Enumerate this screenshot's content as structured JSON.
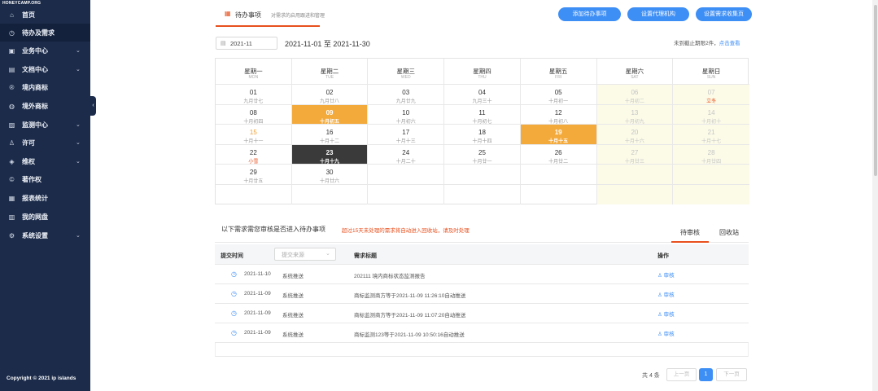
{
  "sidebar": {
    "logo": "HONEYCAMP.ORG",
    "items": [
      {
        "label": "首页",
        "icon": "home-icon",
        "glyph": "⌂",
        "caret": false,
        "active": false
      },
      {
        "label": "待办及需求",
        "icon": "clock-icon",
        "glyph": "◷",
        "caret": false,
        "active": true
      },
      {
        "label": "业务中心",
        "icon": "briefcase-icon",
        "glyph": "▣",
        "caret": true,
        "active": false
      },
      {
        "label": "文档中心",
        "icon": "document-icon",
        "glyph": "▤",
        "caret": true,
        "active": false
      },
      {
        "label": "境内商标",
        "icon": "registered-icon",
        "glyph": "®",
        "caret": false,
        "active": false
      },
      {
        "label": "境外商标",
        "icon": "globe-icon",
        "glyph": "◍",
        "caret": false,
        "active": false
      },
      {
        "label": "监测中心",
        "icon": "monitor-icon",
        "glyph": "▨",
        "caret": true,
        "active": false
      },
      {
        "label": "许可",
        "icon": "user-icon",
        "glyph": "♙",
        "caret": true,
        "active": false
      },
      {
        "label": "维权",
        "icon": "shield-icon",
        "glyph": "◈",
        "caret": true,
        "active": false
      },
      {
        "label": "著作权",
        "icon": "copyright-icon",
        "glyph": "©",
        "caret": false,
        "active": false
      },
      {
        "label": "报表统计",
        "icon": "chart-icon",
        "glyph": "▦",
        "caret": false,
        "active": false
      },
      {
        "label": "我的网盘",
        "icon": "disk-icon",
        "glyph": "▥",
        "caret": false,
        "active": false
      },
      {
        "label": "系统设置",
        "icon": "gear-icon",
        "glyph": "⚙",
        "caret": true,
        "active": false
      }
    ],
    "copyright": "Copyright © 2021 ip islands"
  },
  "header": {
    "tab_title": "待办事项",
    "tab_subtitle": "对需求的启用跟进和管理",
    "buttons": [
      "添加待办事项",
      "设置代理机构",
      "设置需求收集页"
    ]
  },
  "calendar": {
    "month": "2021-11",
    "range": "2021-11-01 至 2021-11-30",
    "deadline_text": "未到截止期限2件，",
    "deadline_link": "点击查看",
    "weekdays": [
      {
        "cn": "星期一",
        "en": "MON"
      },
      {
        "cn": "星期二",
        "en": "TUE"
      },
      {
        "cn": "星期三",
        "en": "WED"
      },
      {
        "cn": "星期四",
        "en": "THU"
      },
      {
        "cn": "星期五",
        "en": "FRI"
      },
      {
        "cn": "星期六",
        "en": "SAT"
      },
      {
        "cn": "星期日",
        "en": "SUN"
      }
    ],
    "weeks": [
      [
        {
          "n": "01",
          "l": "九月廿七"
        },
        {
          "n": "02",
          "l": "九月廿八"
        },
        {
          "n": "03",
          "l": "九月廿九"
        },
        {
          "n": "04",
          "l": "九月三十"
        },
        {
          "n": "05",
          "l": "十月初一"
        },
        {
          "n": "06",
          "l": "十月初二"
        },
        {
          "n": "07",
          "l": "立冬",
          "red": true
        }
      ],
      [
        {
          "n": "08",
          "l": "十月初四"
        },
        {
          "n": "09",
          "l": "十月初五",
          "hl": true
        },
        {
          "n": "10",
          "l": "十月初六"
        },
        {
          "n": "11",
          "l": "十月初七"
        },
        {
          "n": "12",
          "l": "十月初八"
        },
        {
          "n": "13",
          "l": "十月初九"
        },
        {
          "n": "14",
          "l": "十月初十"
        }
      ],
      [
        {
          "n": "15",
          "l": "十月十一",
          "orange": true
        },
        {
          "n": "16",
          "l": "十月十二"
        },
        {
          "n": "17",
          "l": "十月十三"
        },
        {
          "n": "18",
          "l": "十月十四"
        },
        {
          "n": "19",
          "l": "十月十五",
          "hl": true
        },
        {
          "n": "20",
          "l": "十月十六"
        },
        {
          "n": "21",
          "l": "十月十七"
        }
      ],
      [
        {
          "n": "22",
          "l": "小雪",
          "red": true
        },
        {
          "n": "23",
          "l": "十月十九",
          "dark": true
        },
        {
          "n": "24",
          "l": "十月二十"
        },
        {
          "n": "25",
          "l": "十月廿一"
        },
        {
          "n": "26",
          "l": "十月廿二"
        },
        {
          "n": "27",
          "l": "十月廿三"
        },
        {
          "n": "28",
          "l": "十月廿四"
        }
      ],
      [
        {
          "n": "29",
          "l": "十月廿五"
        },
        {
          "n": "30",
          "l": "十月廿六"
        },
        {
          "n": "",
          "l": ""
        },
        {
          "n": "",
          "l": ""
        },
        {
          "n": "",
          "l": ""
        },
        {
          "n": "",
          "l": ""
        },
        {
          "n": "",
          "l": ""
        }
      ],
      [
        {
          "n": "",
          "l": ""
        },
        {
          "n": "",
          "l": ""
        },
        {
          "n": "",
          "l": ""
        },
        {
          "n": "",
          "l": ""
        },
        {
          "n": "",
          "l": ""
        },
        {
          "n": "",
          "l": ""
        },
        {
          "n": "",
          "l": ""
        }
      ]
    ]
  },
  "review": {
    "title": "以下需求需您审核是否进入待办事项",
    "warning": "超过15天未处理的需求将自动进入回收站，请及时处理",
    "tabs": [
      "待审核",
      "回收站"
    ],
    "columns": {
      "time": "提交时间",
      "source_placeholder": "提交来源",
      "title": "需求标题",
      "action": "操作"
    },
    "rows": [
      {
        "date": "2021-11-10",
        "source": "系统推送",
        "title": "202111 境内商标状态监测报告",
        "action": "审核"
      },
      {
        "date": "2021-11-09",
        "source": "系统推送",
        "title": "商标监测商方等于2021-11-09 11:26:10自动推送",
        "action": "审核"
      },
      {
        "date": "2021-11-09",
        "source": "系统推送",
        "title": "商标监测商方等于2021-11-09 11:07:20自动推送",
        "action": "审核"
      },
      {
        "date": "2021-11-09",
        "source": "系统推送",
        "title": "商标监测123等于2021-11-09 10:50:16自动推送",
        "action": "审核"
      }
    ]
  },
  "pagination": {
    "total": "共 4 条",
    "prev": "上一页",
    "current": "1",
    "next": "下一页"
  }
}
